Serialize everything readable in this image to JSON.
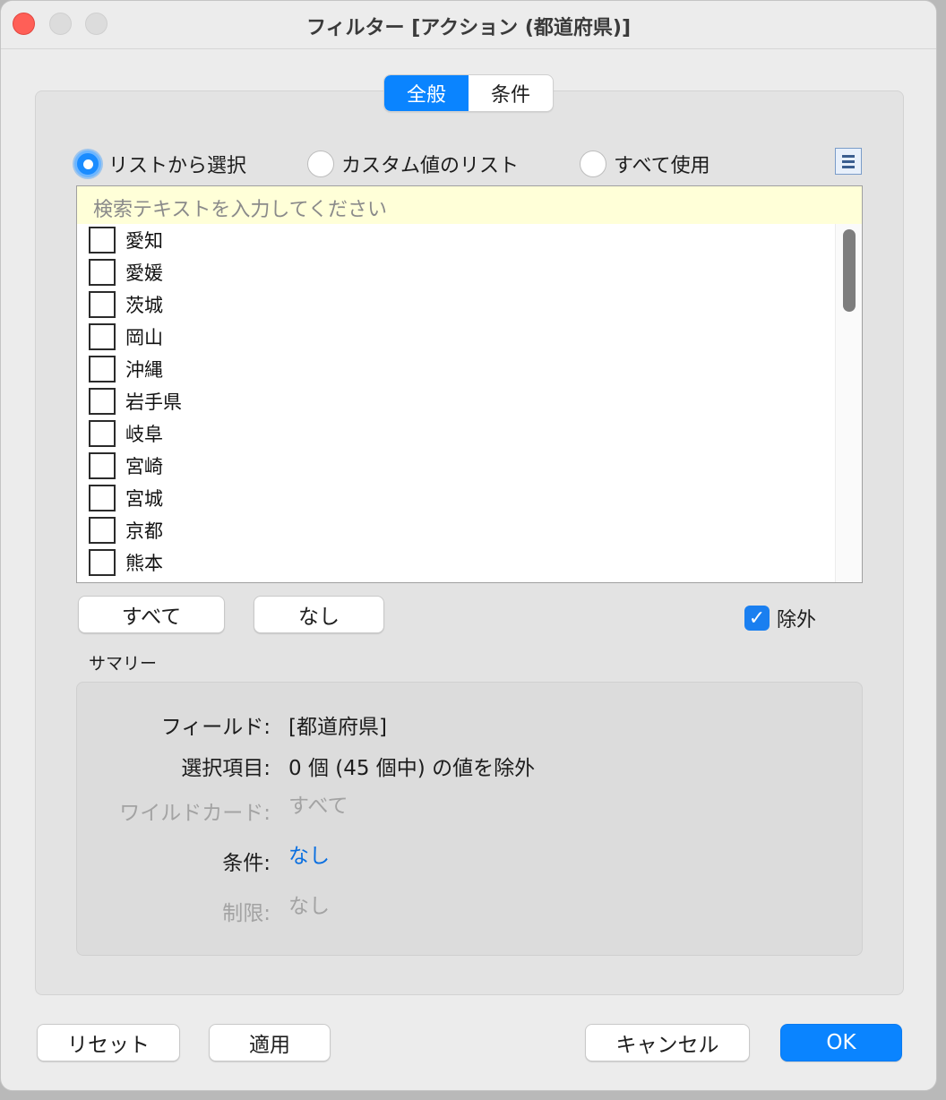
{
  "window": {
    "title": "フィルター [アクション (都道府県)]"
  },
  "tabs": [
    {
      "label": "全般",
      "active": true
    },
    {
      "label": "条件",
      "active": false
    }
  ],
  "mode": {
    "options": [
      {
        "label": "リストから選択",
        "selected": true
      },
      {
        "label": "カスタム値のリスト",
        "selected": false
      },
      {
        "label": "すべて使用",
        "selected": false
      }
    ]
  },
  "search": {
    "placeholder": "検索テキストを入力してください"
  },
  "list": {
    "items": [
      "愛知",
      "愛媛",
      "茨城",
      "岡山",
      "沖縄",
      "岩手県",
      "岐阜",
      "宮崎",
      "宮城",
      "京都",
      "熊本"
    ]
  },
  "buttons": {
    "all": "すべて",
    "none": "なし",
    "reset": "リセット",
    "apply": "適用",
    "cancel": "キャンセル",
    "ok": "OK"
  },
  "exclude": {
    "label": "除外",
    "checked": true
  },
  "summary": {
    "title": "サマリー",
    "field_key": "フィールド:",
    "field_val": "[都道府県]",
    "selection_key": "選択項目:",
    "selection_val": "0 個 (45 個中) の値を除外",
    "wildcard_key": "ワイルドカード:",
    "wildcard_val": "すべて",
    "condition_key": "条件:",
    "condition_val": "なし",
    "limit_key": "制限:",
    "limit_val": "なし"
  },
  "colors": {
    "accent": "#0a84ff",
    "close": "#ff5f57",
    "search_bg": "#ffffd8",
    "link": "#0a6fe0"
  }
}
